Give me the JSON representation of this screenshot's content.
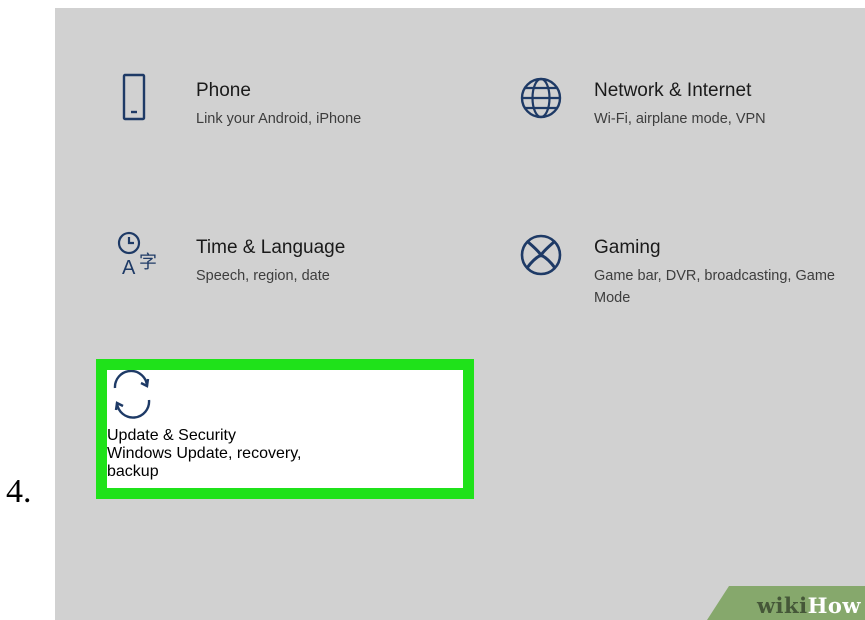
{
  "step": {
    "number": "4."
  },
  "settings": {
    "tiles": [
      {
        "id": "phone",
        "title": "Phone",
        "description": "Link your Android, iPhone",
        "icon": "phone-icon"
      },
      {
        "id": "network",
        "title": "Network & Internet",
        "description": "Wi-Fi, airplane mode, VPN",
        "icon": "globe-icon"
      },
      {
        "id": "time",
        "title": "Time & Language",
        "description": "Speech, region, date",
        "icon": "time-language-icon"
      },
      {
        "id": "gaming",
        "title": "Gaming",
        "description": "Game bar, DVR, broadcasting, Game Mode",
        "icon": "xbox-icon"
      },
      {
        "id": "update",
        "title": "Update & Security",
        "description": "Windows Update, recovery, backup",
        "icon": "sync-arrows-icon",
        "highlighted": true
      }
    ]
  },
  "colors": {
    "background": "#d1d1d1",
    "icon": "#1e3a66",
    "highlight_border": "#1fe21a",
    "watermark_bg": "#86a86c"
  },
  "watermark": {
    "prefix": "wiki",
    "suffix": "How"
  }
}
